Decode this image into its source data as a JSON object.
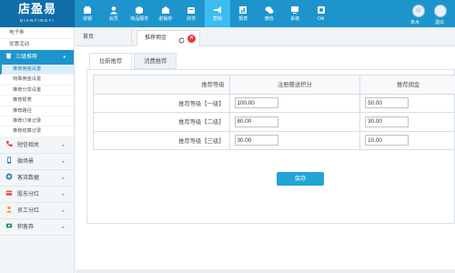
{
  "logo": {
    "main": "店盈易",
    "sub": "DIANYINGYI"
  },
  "nav": [
    {
      "label": "收银",
      "icon": "cashier-icon"
    },
    {
      "label": "会员",
      "icon": "member-icon"
    },
    {
      "label": "商品服务",
      "icon": "goods-icon"
    },
    {
      "label": "进销存",
      "icon": "inventory-icon"
    },
    {
      "label": "财务",
      "icon": "finance-icon"
    },
    {
      "label": "营销",
      "icon": "marketing-icon",
      "active": true
    },
    {
      "label": "报表",
      "icon": "report-icon"
    },
    {
      "label": "微信",
      "icon": "wechat-icon"
    },
    {
      "label": "系统",
      "icon": "system-icon"
    },
    {
      "label": "OA",
      "icon": "oa-icon"
    }
  ],
  "user": {
    "name": "未木",
    "name2": "退出"
  },
  "sidebar": {
    "top_items": [
      "电子券",
      "优惠活动"
    ],
    "group": {
      "label": "三级推荐",
      "caret": "▾"
    },
    "sub_items": [
      {
        "label": "推荐佣金设置",
        "active": true
      },
      {
        "label": "特殊佣金设置"
      },
      {
        "label": "推荐分享设置"
      },
      {
        "label": "推荐报表"
      },
      {
        "label": "推荐路径"
      },
      {
        "label": "推荐订单记录"
      },
      {
        "label": "推荐结算记录"
      }
    ],
    "categories": [
      {
        "label": "短信相关",
        "icon": "phone-icon"
      },
      {
        "label": "微场景",
        "icon": "mobile-icon"
      },
      {
        "label": "客流数据",
        "icon": "traffic-icon"
      },
      {
        "label": "股东分红",
        "icon": "dividend-icon"
      },
      {
        "label": "员工分红",
        "icon": "staff-icon"
      },
      {
        "label": "积客券",
        "icon": "coupon-icon"
      }
    ]
  },
  "tabs": {
    "home": "首页",
    "current": "推荐佣金"
  },
  "subtabs": [
    "拉新推荐",
    "消费推荐"
  ],
  "table": {
    "headers": [
      "推荐等级",
      "注册赠送积分",
      "推荐佣金"
    ],
    "rows": [
      {
        "level": "推荐等级【一级】",
        "points": "100.00",
        "commission": "50.00"
      },
      {
        "level": "推荐等级【二级】",
        "points": "80.00",
        "commission": "30.00"
      },
      {
        "level": "推荐等级【三级】",
        "points": "30.00",
        "commission": "10.00"
      }
    ]
  },
  "save_label": "保存",
  "colors": {
    "primary": "#1d95cc",
    "active_nav": "#3cbcf0",
    "close": "#e23c3c"
  }
}
